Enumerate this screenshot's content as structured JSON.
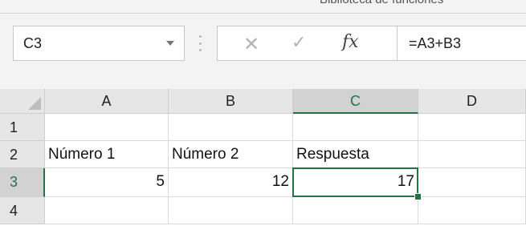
{
  "ribbon": {
    "group_label": "Biblioteca de funciones"
  },
  "formula_bar": {
    "name_box": "C3",
    "cancel_icon": "cancel-x-icon",
    "enter_icon": "checkmark-icon",
    "fx_label": "fx",
    "formula": "=A3+B3"
  },
  "sheet": {
    "columns": [
      "A",
      "B",
      "C",
      "D"
    ],
    "selected_column": "C",
    "rows": [
      "1",
      "2",
      "3",
      "4"
    ],
    "selected_row": "3",
    "cells": {
      "A2": "Número 1",
      "B2": "Número 2",
      "C2": "Respuesta",
      "A3": "5",
      "B3": "12",
      "C3": "17"
    },
    "active_cell": "C3",
    "accent_color": "#217346"
  }
}
